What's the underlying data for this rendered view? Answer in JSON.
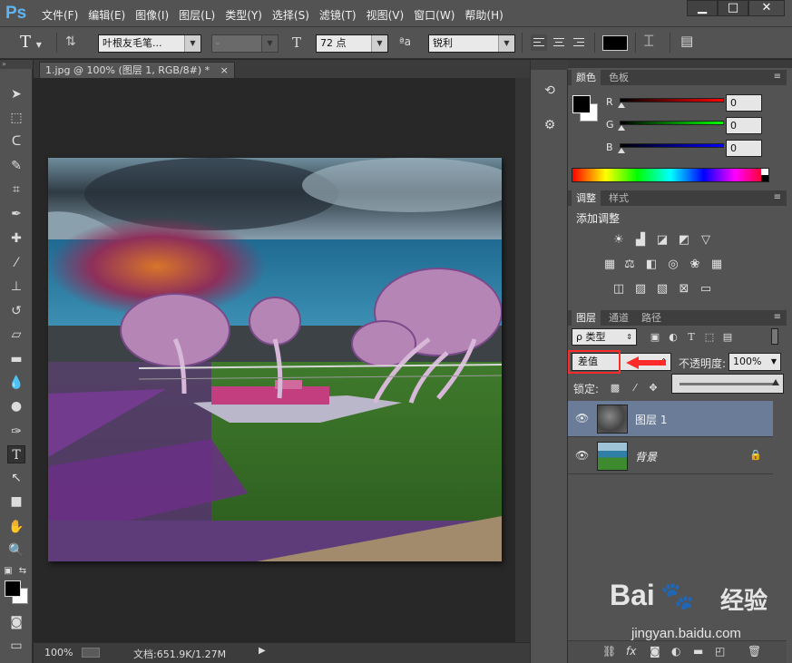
{
  "app": {
    "logo": "Ps"
  },
  "menu": [
    "文件(F)",
    "编辑(E)",
    "图像(I)",
    "图层(L)",
    "类型(Y)",
    "选择(S)",
    "滤镜(T)",
    "视图(V)",
    "窗口(W)",
    "帮助(H)"
  ],
  "window_controls": {
    "minimize": "▁",
    "maximize": "□",
    "close": "✕"
  },
  "options": {
    "font_family": "叶根友毛笔...",
    "font_style": "-",
    "font_size": "72 点",
    "antialias": "锐利",
    "text_color": "#000000"
  },
  "document": {
    "tab_title": "1.jpg @ 100% (图层 1, RGB/8#) *",
    "tab_close": "×"
  },
  "status": {
    "zoom": "100%",
    "doc_info": "文档:651.9K/1.27M"
  },
  "color_panel": {
    "tabs": [
      "颜色",
      "色板"
    ],
    "channels": [
      {
        "label": "R",
        "value": "0",
        "color": "#ff0000"
      },
      {
        "label": "G",
        "value": "0",
        "color": "#00ff00"
      },
      {
        "label": "B",
        "value": "0",
        "color": "#0000ff"
      }
    ]
  },
  "adjustments_panel": {
    "tabs": [
      "调整",
      "样式"
    ],
    "title": "添加调整"
  },
  "layers_panel": {
    "tabs": [
      "图层",
      "通道",
      "路径"
    ],
    "filter": "ρ 类型",
    "blend_mode": "差值",
    "opacity_label": "不透明度:",
    "opacity": "100%",
    "lock_label": "锁定:",
    "layers": [
      {
        "name": "图层 1",
        "selected": true
      },
      {
        "name": "背景",
        "selected": false,
        "locked": true
      }
    ]
  },
  "watermark": {
    "brand": "Bai",
    "brand_suffix": "经验",
    "url": "jingyan.baidu.com"
  }
}
